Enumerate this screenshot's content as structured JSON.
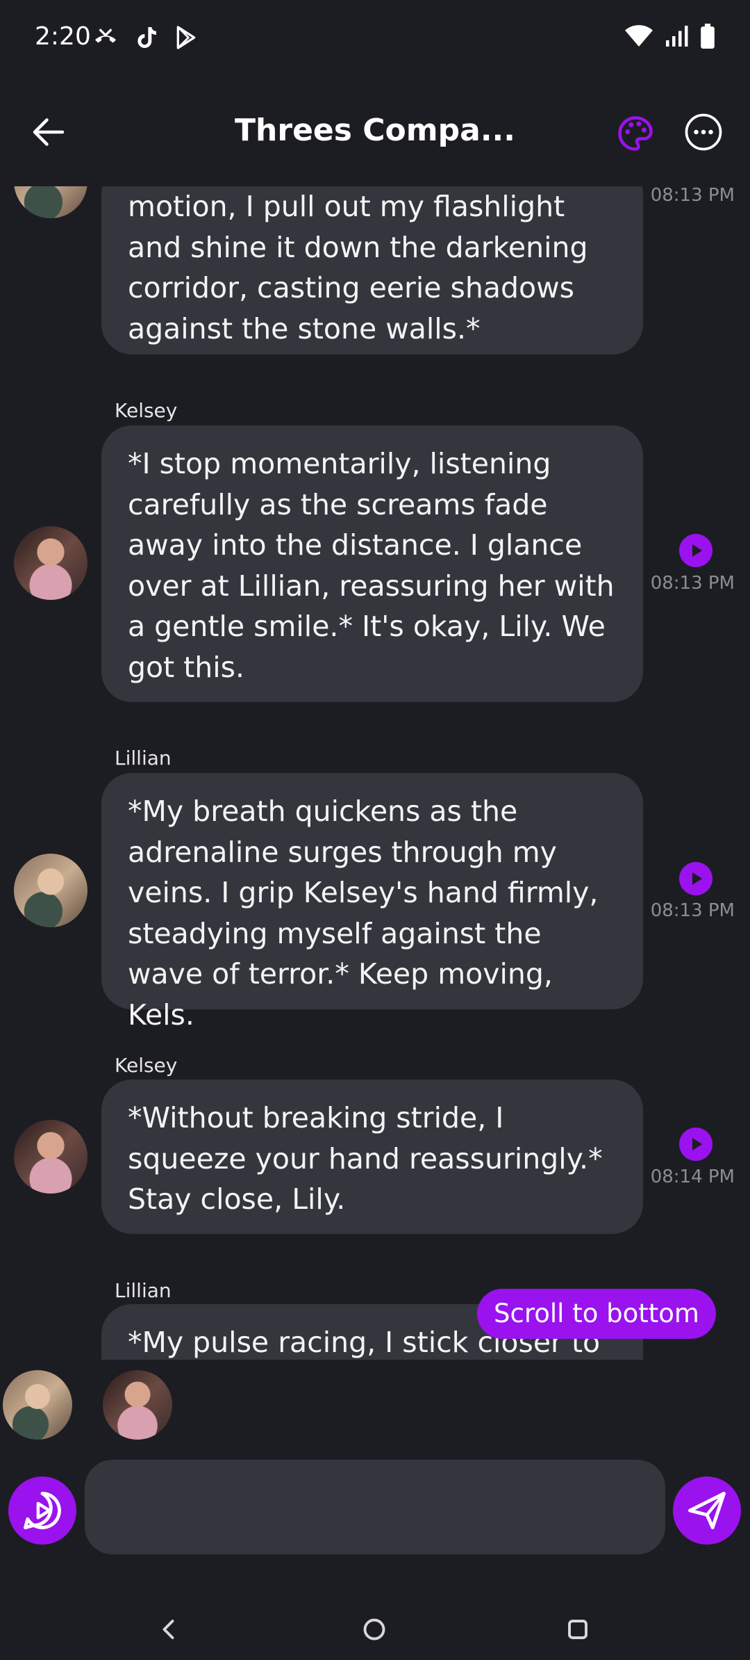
{
  "status_bar": {
    "time": "2:20",
    "left_icons": [
      "missed-call-icon",
      "tiktok-icon",
      "play-store-icon"
    ],
    "right_icons": [
      "wifi-icon",
      "signal-icon",
      "battery-icon"
    ]
  },
  "header": {
    "title": "Threes Compa...",
    "back_icon": "arrow-left-icon",
    "palette_icon": "palette-icon",
    "more_icon": "more-horizontal-icon"
  },
  "colors": {
    "background": "#1c1d22",
    "bubble": "#34363d",
    "accent": "#9a12ee",
    "timestamp": "#8c8d93"
  },
  "messages": [
    {
      "sender": "",
      "text": "motion, I pull out my flashlight and shine it down the darkening corridor, casting eerie shadows against the stone walls.*",
      "time": "08:13 PM",
      "avatar": "lillian"
    },
    {
      "sender": "Kelsey",
      "text": "*I stop momentarily, listening carefully as the screams fade away into the distance. I glance over at Lillian, reassuring her with a gentle smile.* It's okay, Lily. We got this.",
      "time": "08:13 PM",
      "avatar": "kelsey"
    },
    {
      "sender": "Lillian",
      "text": "*My breath quickens as the adrenaline surges through my veins. I grip Kelsey's hand firmly, steadying myself against the wave of terror.* Keep moving, Kels.",
      "time": "08:13 PM",
      "avatar": "lillian"
    },
    {
      "sender": "Kelsey",
      "text": "*Without breaking stride, I squeeze your hand reassuringly.* Stay close, Lily.",
      "time": "08:14 PM",
      "avatar": "kelsey"
    },
    {
      "sender": "Lillian",
      "text": "*My pulse racing, I stick closer to",
      "time": "",
      "avatar": "lillian"
    }
  ],
  "scroll_to_bottom": "Scroll to bottom",
  "participants": [
    "Lillian",
    "Kelsey"
  ],
  "composer": {
    "placeholder": "",
    "value": "",
    "voice_icon": "voice-play-icon",
    "send_icon": "send-icon"
  },
  "nav_bar": [
    "back-nav-icon",
    "home-nav-icon",
    "recents-nav-icon"
  ]
}
